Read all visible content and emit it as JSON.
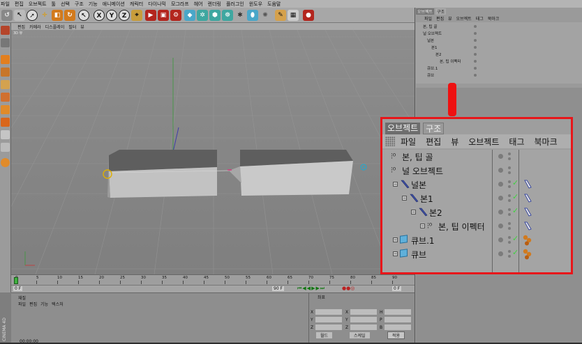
{
  "menubar": [
    "파일",
    "편집",
    "오브젝트",
    "툴",
    "선택",
    "구조",
    "기능",
    "애니메이션",
    "캐릭터",
    "다이나믹",
    "모그라프",
    "헤어",
    "렌더링",
    "플러그인",
    "윈도우",
    "도움말"
  ],
  "toolbar": {
    "x_label": "X",
    "y_label": "Y",
    "z_label": "Z"
  },
  "viewport": {
    "label": "3D 뷰",
    "menu": [
      "편집",
      "카메라",
      "디스플레이",
      "필터",
      "뷰"
    ]
  },
  "timeline": {
    "ticks": [
      "0",
      "5",
      "10",
      "15",
      "20",
      "25",
      "30",
      "35",
      "40",
      "45",
      "50",
      "55",
      "60",
      "65",
      "70",
      "75",
      "80",
      "85",
      "90"
    ],
    "start_frame": "0 F",
    "end_frame": "90 F",
    "current_frame": "0 F"
  },
  "material_panel": {
    "title": "재질",
    "menu": [
      "파일",
      "편집",
      "기능",
      "텍스처"
    ],
    "time": "00:00:00"
  },
  "coord_panel": {
    "title": "좌표",
    "labels": [
      "X",
      "Y",
      "Z"
    ],
    "size_labels": [
      "H",
      "P",
      "B"
    ],
    "mode_world": "월드",
    "mode_scale": "스케일",
    "apply": "적용"
  },
  "side_brand": "CINEMA 4D",
  "object_manager_small": {
    "tabs": [
      "오브젝트",
      "구조"
    ],
    "menu": [
      "파일",
      "편집",
      "뷰",
      "오브젝트",
      "태그",
      "북마크"
    ],
    "rows": [
      "본, 팁 골",
      "널 오브젝트",
      "널본",
      "본1",
      "본2",
      "본, 팁 이펙터",
      "큐브.1",
      "큐브"
    ]
  },
  "object_manager_zoom": {
    "tabs": [
      "오브젝트",
      "구조"
    ],
    "menu": [
      "파일",
      "편집",
      "뷰",
      "오브젝트",
      "태그",
      "북마크"
    ],
    "rows": [
      {
        "name": "본, 팁 골",
        "type": "null",
        "depth": 0,
        "check": false,
        "tag": "none"
      },
      {
        "name": "널 오브젝트",
        "type": "null",
        "depth": 0,
        "check": false,
        "tag": "none"
      },
      {
        "name": "널본",
        "type": "bone",
        "depth": 1,
        "check": true,
        "tag": "bone"
      },
      {
        "name": "본1",
        "type": "bone",
        "depth": 2,
        "check": true,
        "tag": "bone"
      },
      {
        "name": "본2",
        "type": "bone",
        "depth": 3,
        "check": true,
        "tag": "bone"
      },
      {
        "name": "본, 팁 이펙터",
        "type": "null",
        "depth": 4,
        "check": false,
        "tag": "bone"
      },
      {
        "name": "큐브.1",
        "type": "cube",
        "depth": 1,
        "check": true,
        "tag": "material"
      },
      {
        "name": "큐브",
        "type": "cube",
        "depth": 1,
        "check": true,
        "tag": "material"
      }
    ]
  },
  "colors": {
    "callout_border": "#e8161a",
    "check": "#3fd43f",
    "cube_icon": "#5fb0da"
  }
}
